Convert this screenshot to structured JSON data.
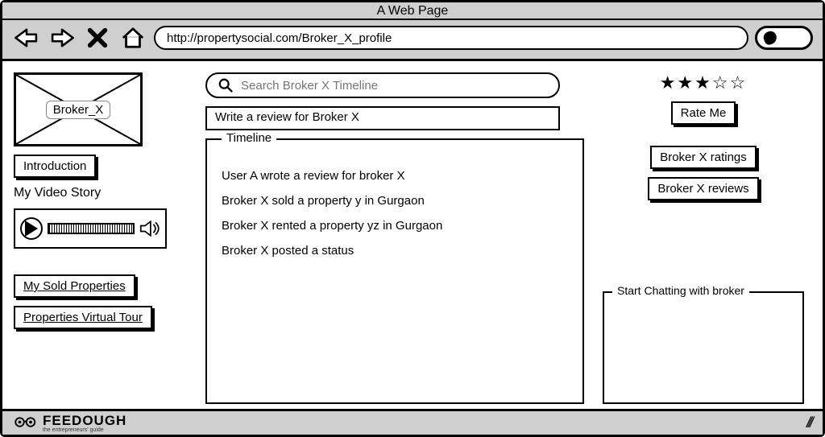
{
  "window": {
    "title": "A Web Page"
  },
  "address_bar": {
    "url": "http://propertysocial.com/Broker_X_profile"
  },
  "left": {
    "avatar_label": "Broker_X",
    "intro_button": "Introduction",
    "video_label": "My Video Story",
    "sold_link": "My Sold Properties",
    "tour_link": "Properties Virtual Tour"
  },
  "mid": {
    "search_placeholder": "Search Broker X Timeline",
    "review_prompt": "Write a review for Broker X",
    "timeline_label": "Timeline",
    "timeline_items": [
      "User A wrote a review for broker X",
      "Broker X sold a property y in Gurgaon",
      "Broker X rented a property yz in Gurgaon",
      "Broker X posted a status"
    ]
  },
  "right": {
    "stars_display": "★★★☆☆",
    "rating_value": 3,
    "rating_max": 5,
    "rate_button": "Rate Me",
    "ratings_button": "Broker X ratings",
    "reviews_button": "Broker X reviews",
    "chat_label": "Start Chatting with broker"
  },
  "footer": {
    "brand": "FEEDOUGH",
    "tagline": "the entrepreneurs' guide"
  }
}
